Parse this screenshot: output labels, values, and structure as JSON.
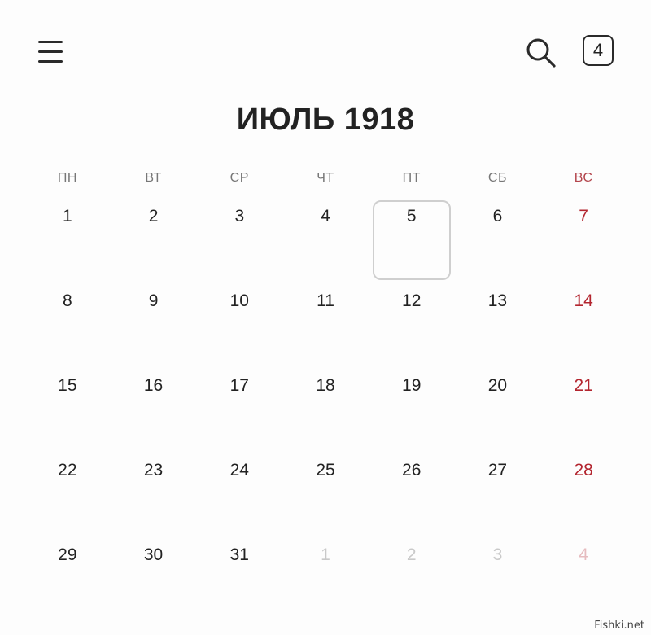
{
  "header": {
    "menu_icon": "hamburger-menu-icon",
    "search_icon": "search-icon",
    "today_badge": "4"
  },
  "calendar": {
    "title": "ИЮЛЬ 1918",
    "weekdays": [
      "ПН",
      "ВТ",
      "СР",
      "ЧТ",
      "ПТ",
      "СБ",
      "ВС"
    ],
    "selected_day": "5",
    "weeks": [
      [
        {
          "d": "1"
        },
        {
          "d": "2"
        },
        {
          "d": "3"
        },
        {
          "d": "4"
        },
        {
          "d": "5",
          "selected": true
        },
        {
          "d": "6"
        },
        {
          "d": "7"
        }
      ],
      [
        {
          "d": "8"
        },
        {
          "d": "9"
        },
        {
          "d": "10"
        },
        {
          "d": "11"
        },
        {
          "d": "12"
        },
        {
          "d": "13"
        },
        {
          "d": "14"
        }
      ],
      [
        {
          "d": "15"
        },
        {
          "d": "16"
        },
        {
          "d": "17"
        },
        {
          "d": "18"
        },
        {
          "d": "19"
        },
        {
          "d": "20"
        },
        {
          "d": "21"
        }
      ],
      [
        {
          "d": "22"
        },
        {
          "d": "23"
        },
        {
          "d": "24"
        },
        {
          "d": "25"
        },
        {
          "d": "26"
        },
        {
          "d": "27"
        },
        {
          "d": "28"
        }
      ],
      [
        {
          "d": "29"
        },
        {
          "d": "30"
        },
        {
          "d": "31"
        },
        {
          "d": "1",
          "other": true
        },
        {
          "d": "2",
          "other": true
        },
        {
          "d": "3",
          "other": true
        },
        {
          "d": "4",
          "other": true
        }
      ]
    ]
  },
  "colors": {
    "sunday": "#b3252f",
    "outside_month": "#c9c9c9",
    "selected_border": "#cfcfcf"
  },
  "watermark": "Fishki.net"
}
